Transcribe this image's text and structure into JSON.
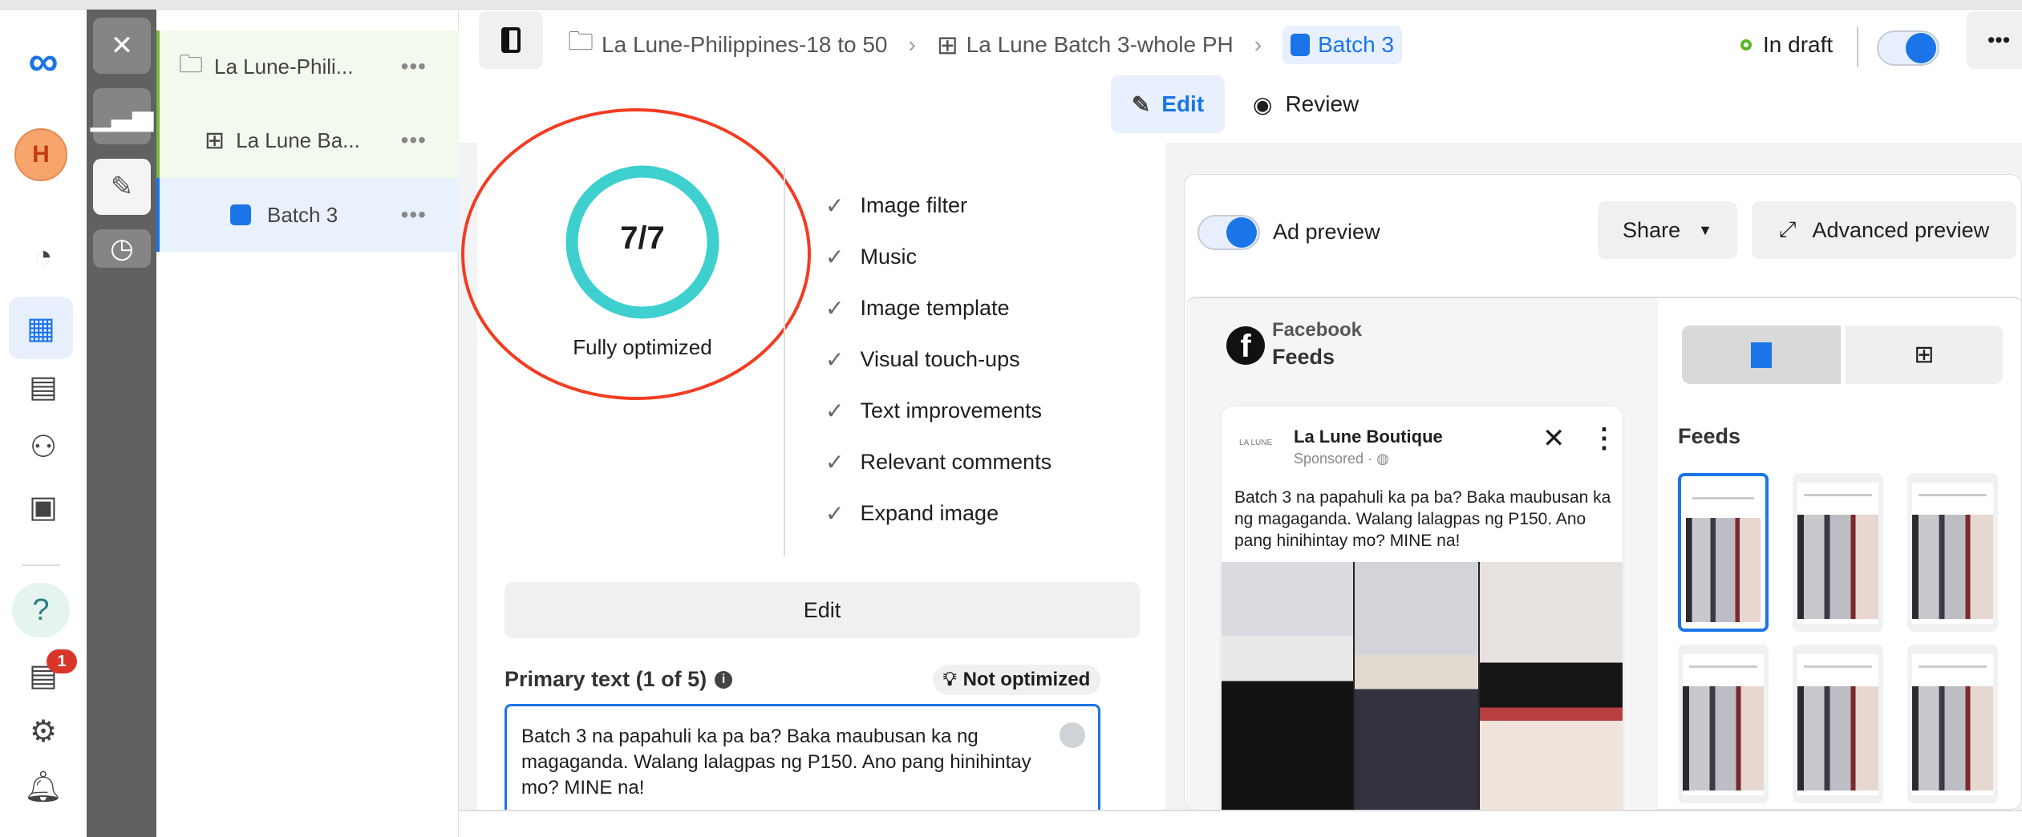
{
  "rail": {
    "avatar_letter": "H",
    "notification_count": "1"
  },
  "tree": {
    "items": [
      {
        "label": "La Lune-Phili...",
        "icon": "folder-icon"
      },
      {
        "label": "La Lune Ba...",
        "icon": "grid-icon"
      },
      {
        "label": "Batch 3",
        "icon": "ad-icon"
      }
    ],
    "more": "•••"
  },
  "header": {
    "breadcrumb": [
      "La Lune-Philippines-18 to 50",
      "La Lune Batch 3-whole PH",
      "Batch 3"
    ],
    "status": "In draft",
    "more": "•••",
    "tabs": [
      "Edit",
      "Review"
    ]
  },
  "optimization": {
    "score": "7/7",
    "label": "Fully optimized",
    "progress": 1.0,
    "items": [
      "Image filter",
      "Music",
      "Image template",
      "Visual touch-ups",
      "Text improvements",
      "Relevant comments",
      "Expand image"
    ],
    "edit_button": "Edit"
  },
  "primary_text": {
    "label": "Primary text (1 of 5)",
    "badge": "Not optimized",
    "value": "Batch 3 na papahuli ka pa ba? Baka maubusan ka ng magaganda. Walang lalagpas ng P150. Ano pang hinihintay mo? MINE na!"
  },
  "preview": {
    "toggle_label": "Ad preview",
    "share": "Share",
    "advanced": "Advanced preview",
    "platform": "Facebook",
    "placement": "Feeds",
    "feeds_heading": "Feeds",
    "post": {
      "page_name": "La Lune Boutique",
      "logo_text": "LA LUNE",
      "sponsored": "Sponsored ·",
      "text": "Batch 3 na papahuli ka pa ba? Baka maubusan ka ng magaganda. Walang lalagpas ng P150. Ano pang hinihintay mo? MINE na!"
    }
  },
  "colors": {
    "accent": "#1b74e8",
    "ring": "#3ecfcf",
    "annotation": "#f23c22",
    "status": "#5fb528"
  }
}
